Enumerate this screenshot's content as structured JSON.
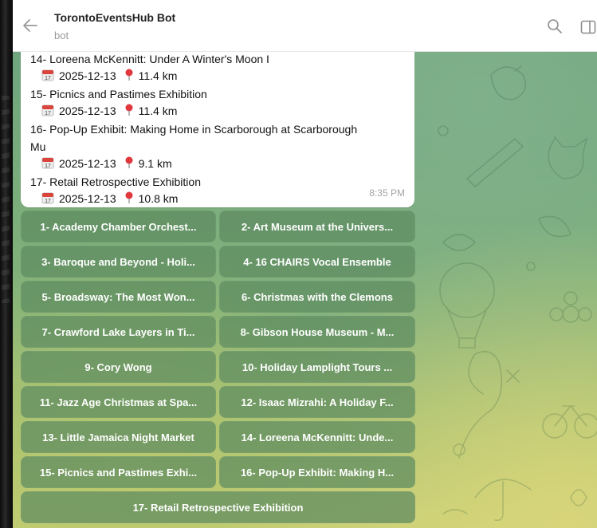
{
  "header": {
    "title": "TorontoEventsHub Bot",
    "subtitle": "bot"
  },
  "message": {
    "time": "8:35 PM",
    "events": [
      {
        "title": "14- Loreena McKennitt: Under A Winter's Moon I",
        "date": "2025-12-13",
        "distance": "11.4 km"
      },
      {
        "title": "15- Picnics and Pastimes Exhibition",
        "date": "2025-12-13",
        "distance": "11.4 km"
      },
      {
        "title": "16- Pop-Up Exhibit: Making Home in Scarborough at Scarborough",
        "title_cont": "Mu",
        "date": "2025-12-13",
        "distance": "9.1 km"
      },
      {
        "title": "17- Retail Retrospective Exhibition",
        "date": "2025-12-13",
        "distance": "10.8 km"
      }
    ]
  },
  "keyboard": {
    "buttons": [
      "1- Academy Chamber Orchest...",
      "2- Art Museum at the Univers...",
      "3- Baroque and Beyond - Holi...",
      "4- 16 CHAIRS Vocal Ensemble",
      "5- Broadsway: The Most Won...",
      "6- Christmas with the Clemons",
      "7- Crawford Lake Layers in Ti...",
      "8- Gibson House Museum - M...",
      "9- Cory Wong",
      "10- Holiday Lamplight Tours ...",
      "11- Jazz Age Christmas at Spa...",
      "12- Isaac Mizrahi: A Holiday F...",
      "13- Little Jamaica Night Market",
      "14- Loreena McKennitt: Unde...",
      "15- Picnics and Pastimes Exhi...",
      "16- Pop-Up Exhibit: Making H...",
      "17- Retail Retrospective Exhibition"
    ]
  },
  "icons": {
    "back": "arrow-left-icon",
    "search": "search-icon",
    "panel": "side-panel-icon",
    "calendar": "calendar-icon",
    "pin": "location-pin-icon"
  },
  "colors": {
    "button_bg": "#5d8a60",
    "pin_red": "#e0383c",
    "calendar_red": "#d9443c"
  }
}
